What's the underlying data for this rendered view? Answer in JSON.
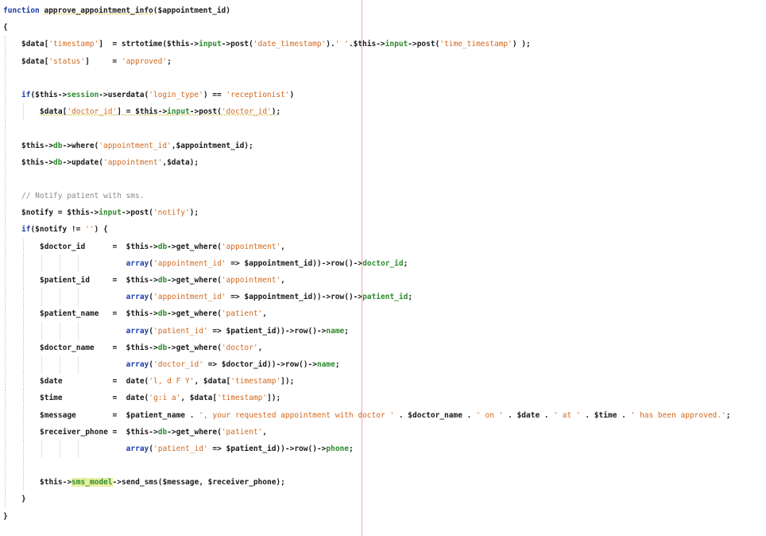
{
  "editor": {
    "lines": [
      {
        "indent": 0,
        "guides": [],
        "tokens": [
          {
            "t": "function ",
            "c": "k"
          },
          {
            "t": "approve_appointment_info",
            "c": "v u"
          },
          {
            "t": "($appointment_id)",
            "c": "v"
          }
        ]
      },
      {
        "indent": 0,
        "guides": [],
        "tokens": [
          {
            "t": "{",
            "c": "v"
          }
        ]
      },
      {
        "indent": 1,
        "guides": [
          0
        ],
        "tokens": [
          {
            "t": "$data[",
            "c": "v"
          },
          {
            "t": "'timestamp'",
            "c": "s"
          },
          {
            "t": "]  = strtotime($this->",
            "c": "v"
          },
          {
            "t": "input",
            "c": "m"
          },
          {
            "t": "->post(",
            "c": "v"
          },
          {
            "t": "'date_timestamp'",
            "c": "s"
          },
          {
            "t": ").",
            "c": "v"
          },
          {
            "t": "' '",
            "c": "s"
          },
          {
            "t": ".$this->",
            "c": "v"
          },
          {
            "t": "input",
            "c": "m"
          },
          {
            "t": "->post(",
            "c": "v"
          },
          {
            "t": "'time_timestamp'",
            "c": "s"
          },
          {
            "t": ") );",
            "c": "v"
          }
        ]
      },
      {
        "indent": 1,
        "guides": [
          0
        ],
        "tokens": [
          {
            "t": "$data[",
            "c": "v"
          },
          {
            "t": "'status'",
            "c": "s"
          },
          {
            "t": "]     = ",
            "c": "v"
          },
          {
            "t": "'approved'",
            "c": "s"
          },
          {
            "t": ";",
            "c": "v"
          }
        ]
      },
      {
        "indent": 1,
        "guides": [
          0
        ],
        "tokens": []
      },
      {
        "indent": 1,
        "guides": [
          0
        ],
        "tokens": [
          {
            "t": "if",
            "c": "k"
          },
          {
            "t": "($this->",
            "c": "v"
          },
          {
            "t": "session",
            "c": "m"
          },
          {
            "t": "->userdata(",
            "c": "v"
          },
          {
            "t": "'login_type'",
            "c": "s"
          },
          {
            "t": ") == ",
            "c": "v"
          },
          {
            "t": "'receptionist'",
            "c": "s"
          },
          {
            "t": ")",
            "c": "v"
          }
        ]
      },
      {
        "indent": 2,
        "guides": [
          0,
          1
        ],
        "tokens": [
          {
            "t": "$data[",
            "c": "v u"
          },
          {
            "t": "'doctor_id'",
            "c": "s u"
          },
          {
            "t": "] = $this->",
            "c": "v u"
          },
          {
            "t": "input",
            "c": "m u"
          },
          {
            "t": "->post(",
            "c": "v u"
          },
          {
            "t": "'doctor_id'",
            "c": "s u"
          },
          {
            "t": ");",
            "c": "v u"
          }
        ]
      },
      {
        "indent": 1,
        "guides": [
          0
        ],
        "tokens": []
      },
      {
        "indent": 1,
        "guides": [
          0
        ],
        "tokens": [
          {
            "t": "$this->",
            "c": "v"
          },
          {
            "t": "db",
            "c": "m"
          },
          {
            "t": "->where(",
            "c": "v"
          },
          {
            "t": "'appointment_id'",
            "c": "s"
          },
          {
            "t": ",$appointment_id);",
            "c": "v"
          }
        ]
      },
      {
        "indent": 1,
        "guides": [
          0
        ],
        "tokens": [
          {
            "t": "$this->",
            "c": "v"
          },
          {
            "t": "db",
            "c": "m"
          },
          {
            "t": "->update(",
            "c": "v"
          },
          {
            "t": "'appointment'",
            "c": "s"
          },
          {
            "t": ",$data);",
            "c": "v"
          }
        ]
      },
      {
        "indent": 1,
        "guides": [
          0
        ],
        "tokens": []
      },
      {
        "indent": 1,
        "guides": [
          0
        ],
        "tokens": [
          {
            "t": "// Notify patient with sms.",
            "c": "c"
          }
        ]
      },
      {
        "indent": 1,
        "guides": [
          0
        ],
        "tokens": [
          {
            "t": "$notify = $this->",
            "c": "v"
          },
          {
            "t": "input",
            "c": "m"
          },
          {
            "t": "->post(",
            "c": "v"
          },
          {
            "t": "'notify'",
            "c": "s"
          },
          {
            "t": ");",
            "c": "v"
          }
        ]
      },
      {
        "indent": 1,
        "guides": [
          0
        ],
        "tokens": [
          {
            "t": "if",
            "c": "k"
          },
          {
            "t": "($notify != ",
            "c": "v"
          },
          {
            "t": "''",
            "c": "s"
          },
          {
            "t": ") {",
            "c": "v"
          }
        ]
      },
      {
        "indent": 2,
        "guides": [
          0,
          1
        ],
        "tokens": [
          {
            "t": "$doctor_id      =  $this->",
            "c": "v"
          },
          {
            "t": "db",
            "c": "m"
          },
          {
            "t": "->get_where(",
            "c": "v"
          },
          {
            "t": "'appointment'",
            "c": "s"
          },
          {
            "t": ",",
            "c": "v"
          }
        ]
      },
      {
        "indent": 2,
        "guides": [
          0,
          1,
          2,
          3,
          4
        ],
        "tokens": [
          {
            "t": "                   ",
            "c": "v"
          },
          {
            "t": "array",
            "c": "k"
          },
          {
            "t": "(",
            "c": "v"
          },
          {
            "t": "'appointment_id'",
            "c": "s"
          },
          {
            "t": " => $appointment_id))->row()->",
            "c": "v"
          },
          {
            "t": "doctor_id",
            "c": "m"
          },
          {
            "t": ";",
            "c": "v"
          }
        ]
      },
      {
        "indent": 2,
        "guides": [
          0,
          1
        ],
        "tokens": [
          {
            "t": "$patient_id     =  $this->",
            "c": "v"
          },
          {
            "t": "db",
            "c": "m"
          },
          {
            "t": "->get_where(",
            "c": "v"
          },
          {
            "t": "'appointment'",
            "c": "s"
          },
          {
            "t": ",",
            "c": "v"
          }
        ]
      },
      {
        "indent": 2,
        "guides": [
          0,
          1,
          2,
          3,
          4
        ],
        "tokens": [
          {
            "t": "                   ",
            "c": "v"
          },
          {
            "t": "array",
            "c": "k"
          },
          {
            "t": "(",
            "c": "v"
          },
          {
            "t": "'appointment_id'",
            "c": "s"
          },
          {
            "t": " => $appointment_id))->row()->",
            "c": "v"
          },
          {
            "t": "patient_id",
            "c": "m"
          },
          {
            "t": ";",
            "c": "v"
          }
        ]
      },
      {
        "indent": 2,
        "guides": [
          0,
          1
        ],
        "tokens": [
          {
            "t": "$patient_name   =  $this->",
            "c": "v"
          },
          {
            "t": "db",
            "c": "m"
          },
          {
            "t": "->get_where(",
            "c": "v"
          },
          {
            "t": "'patient'",
            "c": "s"
          },
          {
            "t": ",",
            "c": "v"
          }
        ]
      },
      {
        "indent": 2,
        "guides": [
          0,
          1,
          2,
          3,
          4
        ],
        "tokens": [
          {
            "t": "                   ",
            "c": "v"
          },
          {
            "t": "array",
            "c": "k"
          },
          {
            "t": "(",
            "c": "v"
          },
          {
            "t": "'patient_id'",
            "c": "s"
          },
          {
            "t": " => $patient_id))->row()->",
            "c": "v"
          },
          {
            "t": "name",
            "c": "m"
          },
          {
            "t": ";",
            "c": "v"
          }
        ]
      },
      {
        "indent": 2,
        "guides": [
          0,
          1
        ],
        "tokens": [
          {
            "t": "$doctor_name    =  $this->",
            "c": "v"
          },
          {
            "t": "db",
            "c": "m"
          },
          {
            "t": "->get_where(",
            "c": "v"
          },
          {
            "t": "'doctor'",
            "c": "s"
          },
          {
            "t": ",",
            "c": "v"
          }
        ]
      },
      {
        "indent": 2,
        "guides": [
          0,
          1,
          2,
          3,
          4
        ],
        "tokens": [
          {
            "t": "                   ",
            "c": "v"
          },
          {
            "t": "array",
            "c": "k"
          },
          {
            "t": "(",
            "c": "v"
          },
          {
            "t": "'doctor_id'",
            "c": "s"
          },
          {
            "t": " => $doctor_id))->row()->",
            "c": "v"
          },
          {
            "t": "name",
            "c": "m"
          },
          {
            "t": ";",
            "c": "v"
          }
        ]
      },
      {
        "indent": 2,
        "guides": [
          0,
          1
        ],
        "tokens": [
          {
            "t": "$date           =  date(",
            "c": "v"
          },
          {
            "t": "'l, d F Y'",
            "c": "s"
          },
          {
            "t": ", $data[",
            "c": "v"
          },
          {
            "t": "'timestamp'",
            "c": "s"
          },
          {
            "t": "]);",
            "c": "v"
          }
        ]
      },
      {
        "indent": 2,
        "guides": [
          0,
          1
        ],
        "tokens": [
          {
            "t": "$time           =  date(",
            "c": "v"
          },
          {
            "t": "'g:i a'",
            "c": "s"
          },
          {
            "t": ", $data[",
            "c": "v"
          },
          {
            "t": "'timestamp'",
            "c": "s"
          },
          {
            "t": "]);",
            "c": "v"
          }
        ]
      },
      {
        "indent": 2,
        "guides": [
          0,
          1
        ],
        "tokens": [
          {
            "t": "$message        =  $patient_name . ",
            "c": "v"
          },
          {
            "t": "', your requested appointment with doctor '",
            "c": "s"
          },
          {
            "t": " . $doctor_name . ",
            "c": "v"
          },
          {
            "t": "' on '",
            "c": "s"
          },
          {
            "t": " . $date . ",
            "c": "v"
          },
          {
            "t": "' at '",
            "c": "s"
          },
          {
            "t": " . $time . ",
            "c": "v"
          },
          {
            "t": "' has been approved.'",
            "c": "s"
          },
          {
            "t": ";",
            "c": "v"
          }
        ]
      },
      {
        "indent": 2,
        "guides": [
          0,
          1
        ],
        "tokens": [
          {
            "t": "$receiver_phone =  $this->",
            "c": "v"
          },
          {
            "t": "db",
            "c": "m"
          },
          {
            "t": "->get_where(",
            "c": "v"
          },
          {
            "t": "'patient'",
            "c": "s"
          },
          {
            "t": ",",
            "c": "v"
          }
        ]
      },
      {
        "indent": 2,
        "guides": [
          0,
          1,
          2,
          3,
          4
        ],
        "tokens": [
          {
            "t": "                   ",
            "c": "v"
          },
          {
            "t": "array",
            "c": "k"
          },
          {
            "t": "(",
            "c": "v"
          },
          {
            "t": "'patient_id'",
            "c": "s"
          },
          {
            "t": " => $patient_id))->row()->",
            "c": "v"
          },
          {
            "t": "phone",
            "c": "m"
          },
          {
            "t": ";",
            "c": "v"
          }
        ]
      },
      {
        "indent": 2,
        "guides": [
          0,
          1
        ],
        "tokens": []
      },
      {
        "indent": 2,
        "guides": [
          0,
          1
        ],
        "tokens": [
          {
            "t": "$this->",
            "c": "v"
          },
          {
            "t": "sms_model",
            "c": "m hl"
          },
          {
            "t": "->send_sms($message, $receiver_phone);",
            "c": "v"
          }
        ]
      },
      {
        "indent": 1,
        "guides": [
          0
        ],
        "tokens": [
          {
            "t": "}",
            "c": "v"
          }
        ]
      },
      {
        "indent": 0,
        "guides": [],
        "tokens": [
          {
            "t": "}",
            "c": "v"
          }
        ]
      }
    ]
  }
}
